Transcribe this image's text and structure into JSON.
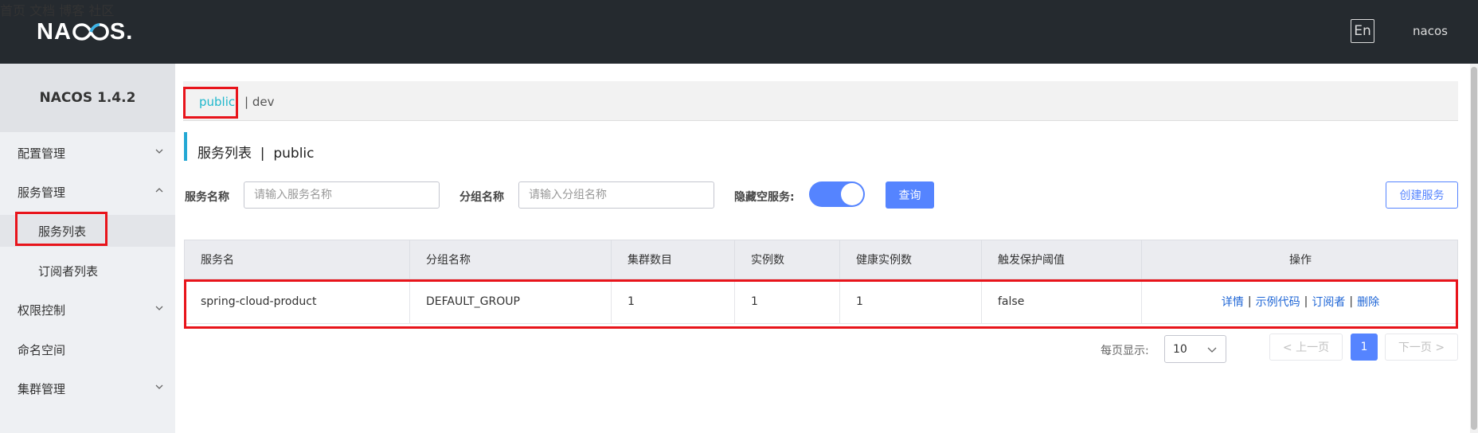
{
  "header": {
    "logo_text_left": "NA",
    "logo_text_right": "S",
    "logo_dot": ".",
    "nav": [
      "首页",
      "文档",
      "博客",
      "社区"
    ],
    "lang": "En",
    "user": "nacos"
  },
  "sidebar": {
    "version": "NACOS 1.4.2",
    "items": [
      {
        "label": "配置管理"
      },
      {
        "label": "服务管理"
      },
      {
        "label": "服务列表"
      },
      {
        "label": "订阅者列表"
      },
      {
        "label": "权限控制"
      },
      {
        "label": "命名空间"
      },
      {
        "label": "集群管理"
      }
    ]
  },
  "namespace": {
    "current": "public",
    "separator": "| dev"
  },
  "page": {
    "title": "服务列表  |  public"
  },
  "filters": {
    "service_label": "服务名称",
    "service_placeholder": "请输入服务名称",
    "group_label": "分组名称",
    "group_placeholder": "请输入分组名称",
    "hide_empty_label": "隐藏空服务:",
    "hide_empty_on": true,
    "query_button": "查询",
    "create_button": "创建服务"
  },
  "table": {
    "columns": [
      "服务名",
      "分组名称",
      "集群数目",
      "实例数",
      "健康实例数",
      "触发保护阈值",
      "操作"
    ],
    "rows": [
      {
        "service": "spring-cloud-product",
        "group": "DEFAULT_GROUP",
        "clusters": "1",
        "instances": "1",
        "healthy": "1",
        "threshold": "false",
        "ops": [
          "详情",
          "示例代码",
          "订阅者",
          "删除"
        ]
      }
    ]
  },
  "pagination": {
    "per_page_label": "每页显示:",
    "per_page_value": "10",
    "prev": "< 上一页",
    "next": "下一页 >",
    "current_page": "1"
  },
  "colors": {
    "topbar": "#252a2f",
    "primary": "#5584ff",
    "highlight_box": "#e8141b",
    "namespace_active": "#20b8cc"
  }
}
